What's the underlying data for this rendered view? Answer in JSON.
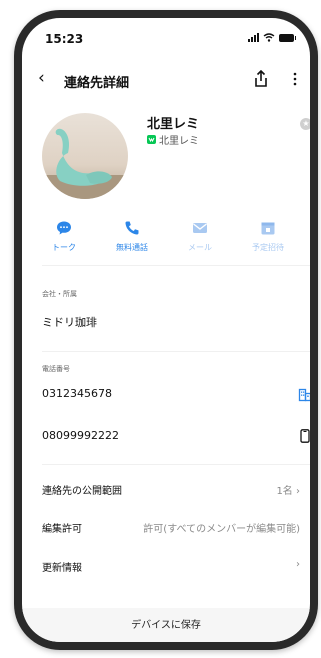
{
  "status": {
    "time": "15:23"
  },
  "header": {
    "title": "連絡先詳細"
  },
  "profile": {
    "name": "北里レミ",
    "sub_name": "北里レミ"
  },
  "actions": [
    {
      "label": "トーク",
      "icon": "chat-bubble-icon",
      "enabled": true
    },
    {
      "label": "無料通話",
      "icon": "phone-icon",
      "enabled": true
    },
    {
      "label": "メール",
      "icon": "mail-icon",
      "enabled": false
    },
    {
      "label": "予定招待",
      "icon": "calendar-icon",
      "enabled": false
    }
  ],
  "company": {
    "label": "会社・所属",
    "value": "ミドリ珈琲"
  },
  "phone": {
    "label": "電話番号",
    "numbers": [
      "0312345678",
      "08099992222"
    ]
  },
  "settings": [
    {
      "label": "連絡先の公開範囲",
      "value": "1名"
    },
    {
      "label": "編集許可",
      "value": "許可(すべてのメンバーが編集可能)"
    },
    {
      "label": "更新情報",
      "value": ""
    }
  ],
  "footer": {
    "save_label": "デバイスに保存"
  },
  "colors": {
    "accent": "#2c86e8",
    "accent_disabled": "#a9c9f1",
    "line_green": "#06c755"
  }
}
